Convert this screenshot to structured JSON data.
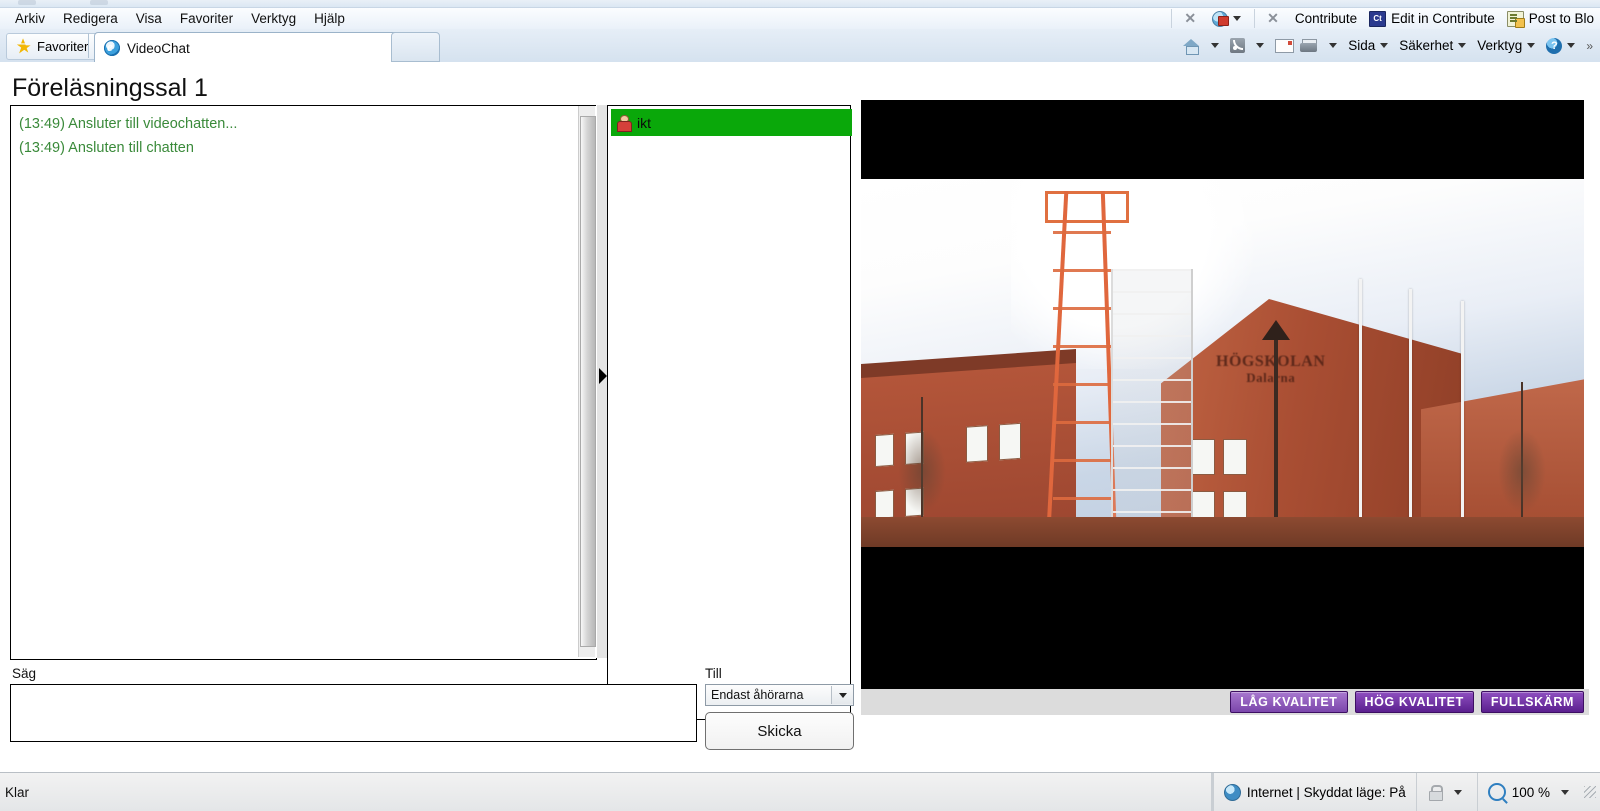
{
  "browser": {
    "menu": [
      "Arkiv",
      "Redigera",
      "Visa",
      "Favoriter",
      "Verktyg",
      "Hjälp"
    ],
    "menu_right": {
      "close_label": "✕",
      "contribute_close": "✕",
      "contribute_label": "Contribute",
      "edit_in_contribute": "Edit in Contribute",
      "contribute_icon_text": "Ct",
      "post_to_blog": "Post to Blo"
    },
    "favorites_label": "Favoriter",
    "tab_label": "VideoChat",
    "command_bar": {
      "page": "Sida",
      "safety": "Säkerhet",
      "tools": "Verktyg",
      "help_glyph": "?",
      "overflow": "»"
    }
  },
  "page": {
    "title": "Föreläsningssal 1",
    "chat_messages": [
      "(13:49) Ansluter till videochatten...",
      "(13:49) Ansluten till chatten"
    ],
    "users": [
      {
        "name": "ikt"
      }
    ],
    "say_label": "Säg",
    "say_value": "",
    "to_label": "Till",
    "to_selected": "Endast åhörarna",
    "to_options": [
      "Endast åhörarna"
    ],
    "send_label": "Skicka",
    "video": {
      "sign_line1": "HÖGSKOLAN",
      "sign_line2": "Dalarna",
      "buttons": [
        {
          "label": "LÅG KVALITET",
          "style": "light"
        },
        {
          "label": "HÖG KVALITET",
          "style": "dark"
        },
        {
          "label": "FULLSKÄRM",
          "style": "dark"
        }
      ]
    }
  },
  "status": {
    "left": "Klar",
    "zone": "Internet | Skyddat läge: På",
    "zoom": "100 %"
  },
  "colors": {
    "user_highlight": "#0aa80a",
    "chat_text": "#3a8a3a",
    "quality_button": "#5a1f8e"
  }
}
